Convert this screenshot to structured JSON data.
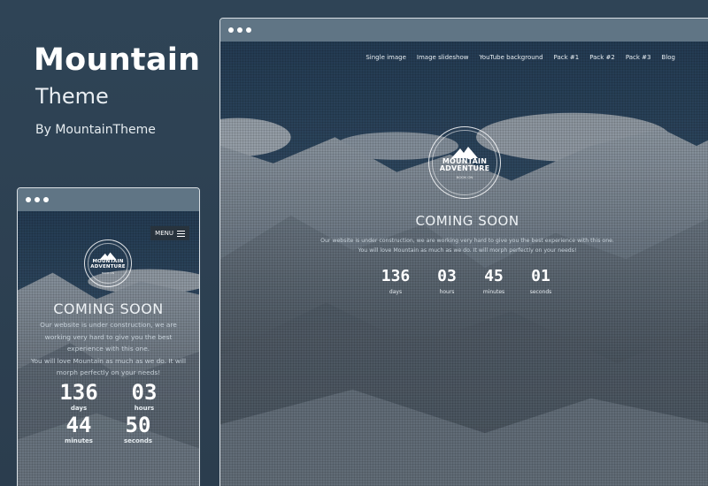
{
  "promo": {
    "title": "Mountain",
    "subtitle": "Theme",
    "by": "By MountainTheme"
  },
  "desktop": {
    "nav": [
      "Single image",
      "Image slideshow",
      "YouTube background",
      "Pack #1",
      "Pack #2",
      "Pack #3",
      "Blog"
    ],
    "logo": {
      "line1": "MOUNTAIN",
      "line2": "ADVENTURE",
      "line3": "BOOK ON"
    },
    "heading": "COMING SOON",
    "sub_line1": "Our website is under construction, we are working very hard to give you the best experience with this one.",
    "sub_line2": "You will love Mountain as much as we do. It will morph perfectly on your needs!",
    "countdown": [
      {
        "value": "136",
        "unit": "days"
      },
      {
        "value": "03",
        "unit": "hours"
      },
      {
        "value": "45",
        "unit": "minutes"
      },
      {
        "value": "01",
        "unit": "seconds"
      }
    ]
  },
  "mobile": {
    "menu_label": "MENU",
    "logo": {
      "line1": "MOUNTAIN",
      "line2": "ADVENTURE",
      "line3": "BOOK ON"
    },
    "heading": "COMING SOON",
    "sub_line1": "Our website is under construction, we are working very hard to give you the best experience with this one.",
    "sub_line2": "You will love Mountain as much as we do. It will morph perfectly on your needs!",
    "countdown": [
      {
        "value": "136",
        "unit": "days"
      },
      {
        "value": "03",
        "unit": "hours"
      },
      {
        "value": "44",
        "unit": "minutes"
      },
      {
        "value": "50",
        "unit": "seconds"
      }
    ]
  },
  "colors": {
    "background": "#2f4456",
    "frame_bar": "#607585",
    "menu_button": "#28333d"
  }
}
